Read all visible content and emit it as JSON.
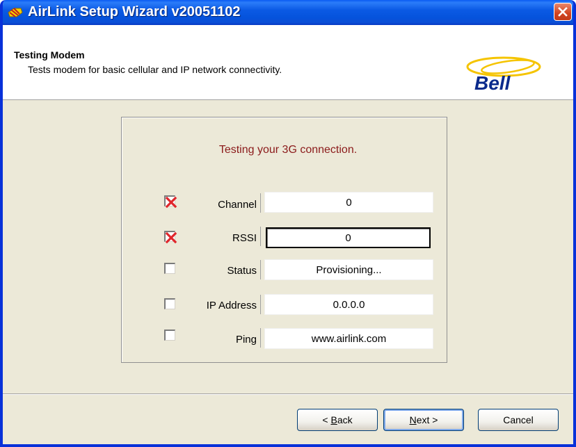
{
  "window": {
    "title": "AirLink Setup Wizard v20051102",
    "icons": {
      "app": "airlink-app-icon",
      "close": "close-icon"
    }
  },
  "header": {
    "title": "Testing Modem",
    "subtitle": "Tests modem for basic cellular and IP network connectivity.",
    "logo_text": "Bell"
  },
  "panel": {
    "message": "Testing your 3G connection.",
    "rows": [
      {
        "label": "Channel",
        "value": "0",
        "status": "failed"
      },
      {
        "label": "RSSI",
        "value": "0",
        "status": "failed"
      },
      {
        "label": "Status",
        "value": "Provisioning...",
        "status": "unchecked"
      },
      {
        "label": "IP Address",
        "value": "0.0.0.0",
        "status": "unchecked"
      },
      {
        "label": "Ping",
        "value": "www.airlink.com",
        "status": "unchecked"
      }
    ]
  },
  "buttons": {
    "back": {
      "mnemonic": "B",
      "rest": "ack",
      "prefix": "< "
    },
    "next": {
      "mnemonic": "N",
      "rest": "ext >"
    },
    "cancel": "Cancel"
  },
  "colors": {
    "titlebar": "#0a5bf2",
    "message": "#8b1a1a",
    "fail_x": "#e0262b",
    "logo": "#f5c400"
  }
}
